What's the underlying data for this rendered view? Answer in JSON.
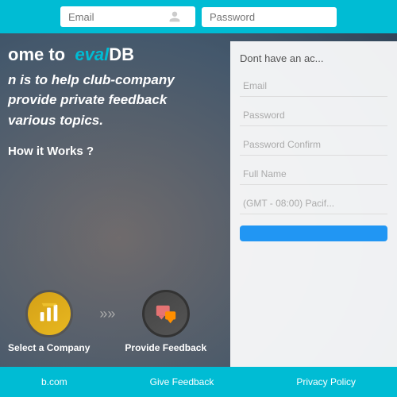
{
  "header": {
    "email_placeholder": "Email",
    "password_placeholder": "Password"
  },
  "hero": {
    "welcome_prefix": "ome to",
    "brand_eval": "eval",
    "brand_db": "DB",
    "subtitle_line1": "n is to help club-company",
    "subtitle_line2": "provide private feedback",
    "subtitle_line3": "various topics.",
    "how_it_works": "How it Works ?",
    "step1_label": "Select a Company",
    "step2_label": "Provide Feedback"
  },
  "register": {
    "title": "Dont have an ac...",
    "email_placeholder": "Email",
    "password_placeholder": "Password",
    "confirm_placeholder": "Password Confirm",
    "fullname_placeholder": "Full Name",
    "timezone_placeholder": "(GMT - 08:00) Pacif...",
    "btn_label": ""
  },
  "footer": {
    "link1": "b.com",
    "link2": "Give Feedback",
    "link3": "Privacy Policy"
  }
}
